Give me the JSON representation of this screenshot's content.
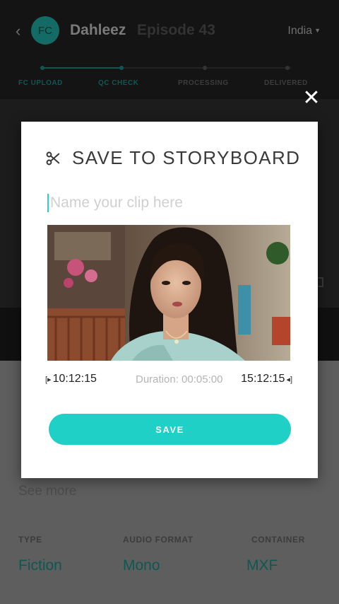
{
  "header": {
    "avatar_initials": "FC",
    "show_name": "Dahleez",
    "episode": "Episode 43",
    "region": "India"
  },
  "pipeline": {
    "steps": [
      "FC UPLOAD",
      "QC CHECK",
      "PROCESSING",
      "DELIVERED"
    ],
    "completed_count": 2
  },
  "details": {
    "see_more": "See more",
    "meta": [
      {
        "label": "TYPE",
        "value": "Fiction"
      },
      {
        "label": "AUDIO FORMAT",
        "value": "Mono"
      },
      {
        "label": "CONTAINER",
        "value": "MXF"
      }
    ]
  },
  "modal": {
    "title": "SAVE TO STORYBOARD",
    "title_icon": "scissors-icon",
    "close_icon": "close-icon",
    "clip_name_placeholder": "Name your clip here",
    "clip_name_value": "",
    "start_time": "10:12:15",
    "duration_text": "Duration: 00:05:00",
    "end_time": "15:12:15",
    "save_label": "SAVE"
  },
  "colors": {
    "accent": "#1fd0c6",
    "dark_bar": "#141414"
  }
}
